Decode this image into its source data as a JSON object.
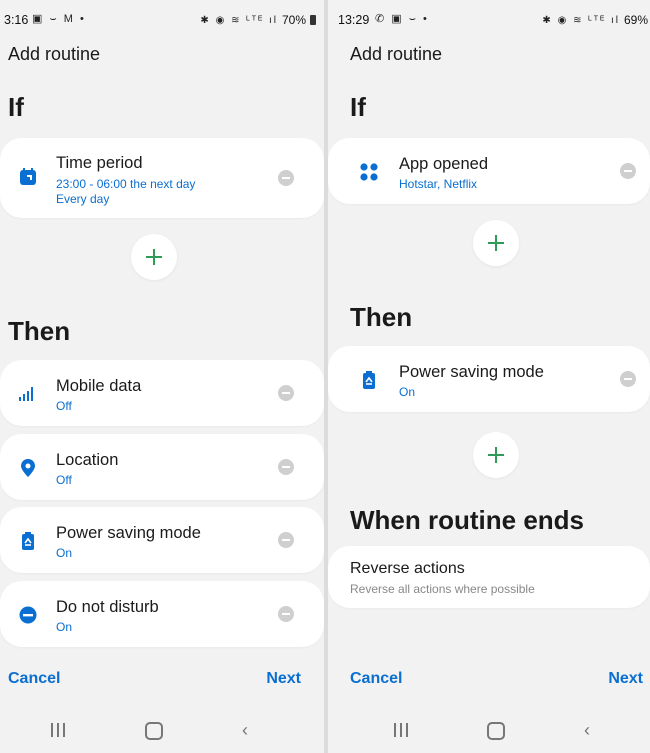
{
  "left": {
    "status": {
      "time": "3:16",
      "icons": "▣ ⌣ M •",
      "right_icons": "✱ ◉ ≋ ᴸᵀᴱ ıl",
      "battery": "70%"
    },
    "title": "Add routine",
    "if_heading": "If",
    "then_heading": "Then",
    "if_card": {
      "name": "Time period",
      "sub1": "23:00 - 06:00 the next day",
      "sub2": "Every day"
    },
    "then_items": [
      {
        "name": "Mobile data",
        "sub": "Off"
      },
      {
        "name": "Location",
        "sub": "Off"
      },
      {
        "name": "Power saving mode",
        "sub": "On"
      },
      {
        "name": "Do not disturb",
        "sub": "On"
      }
    ],
    "cancel": "Cancel",
    "next": "Next"
  },
  "right": {
    "status": {
      "time": "13:29",
      "icons": "✆ ▣ ⌣ •",
      "right_icons": "✱ ◉ ≋ ᴸᵀᴱ ıl",
      "battery": "69%"
    },
    "title": "Add routine",
    "if_heading": "If",
    "then_heading": "Then",
    "ends_heading": "When routine ends",
    "if_card": {
      "name": "App opened",
      "sub": "Hotstar, Netflix"
    },
    "then_card": {
      "name": "Power saving mode",
      "sub": "On"
    },
    "reverse": {
      "title": "Reverse actions",
      "desc": "Reverse all actions where possible"
    },
    "cancel": "Cancel",
    "next": "Next"
  },
  "colors": {
    "accent_blue": "#0a6fd0",
    "add_green": "#2e9b57",
    "background": "#f2f2f2",
    "card": "#ffffff"
  },
  "icons": {
    "time_period": "calendar-icon",
    "mobile_data": "signal-bars-icon",
    "location": "location-pin-icon",
    "power_saving": "battery-recycle-icon",
    "do_not_disturb": "minus-circle-icon",
    "app_opened": "four-dots-grid-icon"
  }
}
